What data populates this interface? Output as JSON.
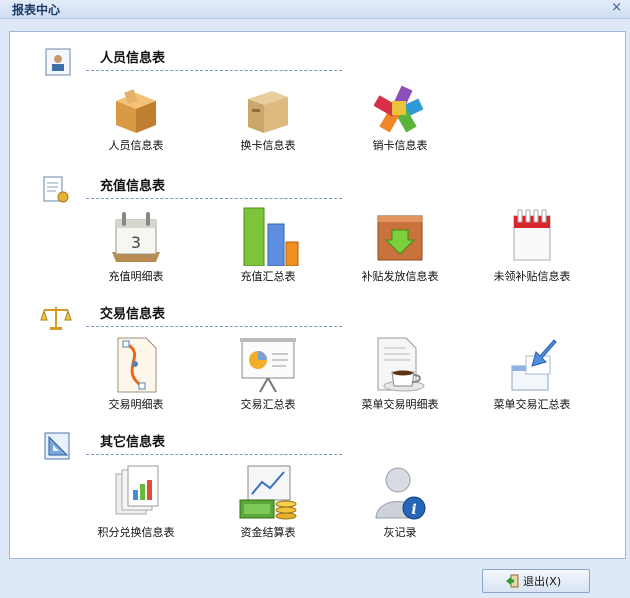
{
  "window": {
    "title": "报表中心",
    "close": "×"
  },
  "sections": [
    {
      "title": "人员信息表",
      "items": [
        "人员信息表",
        "换卡信息表",
        "销卡信息表"
      ]
    },
    {
      "title": "充值信息表",
      "items": [
        "充值明细表",
        "充值汇总表",
        "补贴发放信息表",
        "未领补贴信息表"
      ]
    },
    {
      "title": "交易信息表",
      "items": [
        "交易明细表",
        "交易汇总表",
        "菜单交易明细表",
        "菜单交易汇总表"
      ]
    },
    {
      "title": "其它信息表",
      "items": [
        "积分兑换信息表",
        "资金结算表",
        "灰记录"
      ]
    }
  ],
  "calendar_day": "3",
  "footer": {
    "exit_label": "退出(X)"
  }
}
